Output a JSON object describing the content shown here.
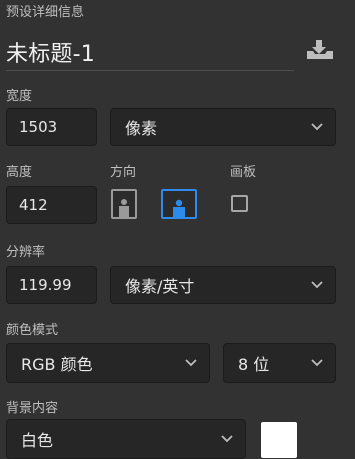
{
  "panel": {
    "header": "预设详细信息",
    "document_title": "未标题-1",
    "save_preset_icon": "download-tray-icon"
  },
  "width": {
    "label": "宽度",
    "value": "1503",
    "unit": "像素"
  },
  "height": {
    "label": "高度",
    "value": "412"
  },
  "orientation": {
    "label": "方向",
    "selected": "landscape"
  },
  "artboard": {
    "label": "画板",
    "checked": false
  },
  "resolution": {
    "label": "分辨率",
    "value": "119.99",
    "unit": "像素/英寸"
  },
  "color_mode": {
    "label": "颜色模式",
    "mode": "RGB 颜色",
    "depth": "8 位"
  },
  "background": {
    "label": "背景内容",
    "value": "白色",
    "swatch": "#ffffff"
  },
  "colors": {
    "accent": "#2d8ceb",
    "panel_bg": "#323232",
    "field_bg": "#262626"
  }
}
